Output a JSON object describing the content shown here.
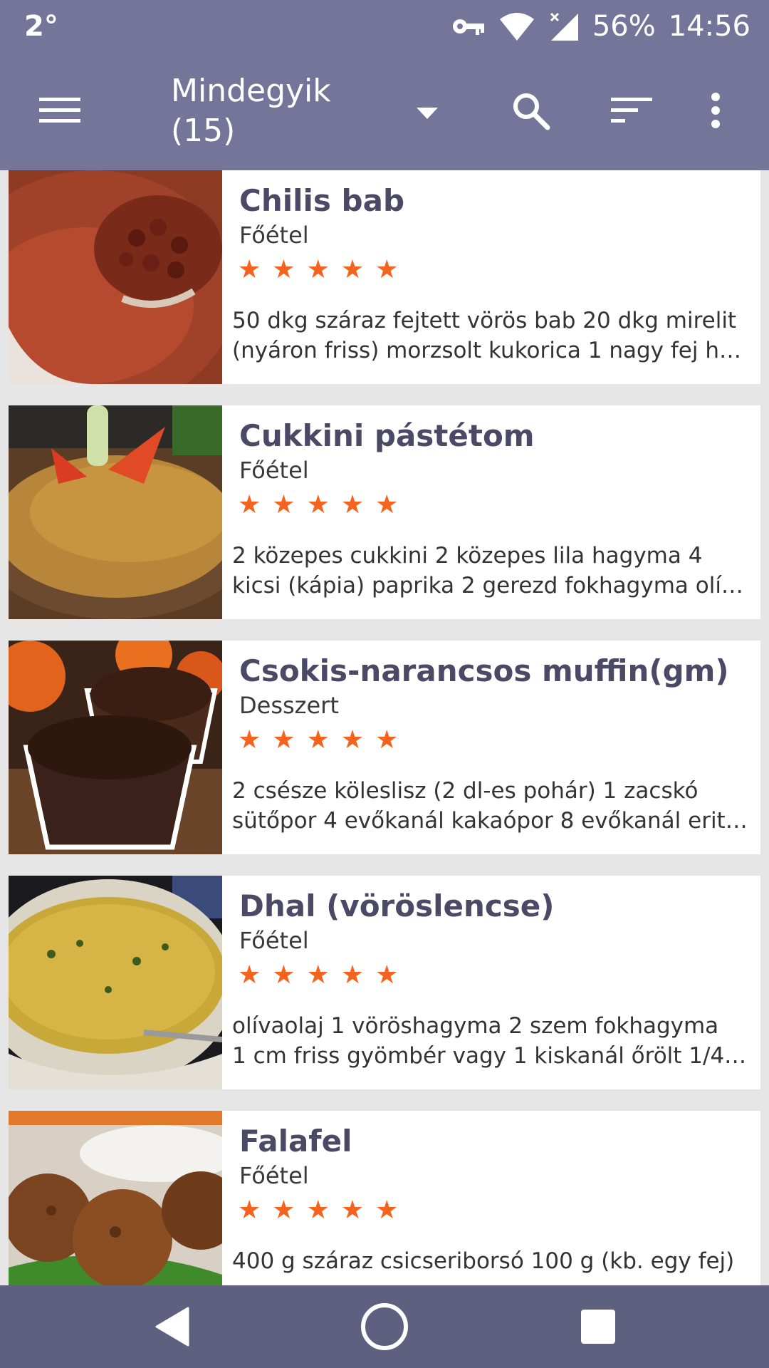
{
  "status": {
    "temperature": "2°",
    "battery": "56%",
    "time": "14:56"
  },
  "appbar": {
    "title_line1": "Mindegyik",
    "title_line2": "(15)"
  },
  "recipes": [
    {
      "title": "Chilis bab",
      "category": "Főétel",
      "rating": 5,
      "desc_line1": "50 dkg száraz fejtett vörös bab 20 dkg mirelit",
      "desc_line2": "(nyáron friss) morzsolt kukorica 1 nagy fej h…"
    },
    {
      "title": "Cukkini pástétom",
      "category": "Főétel",
      "rating": 5,
      "desc_line1": "2 közepes cukkini 2 közepes lila hagyma 4",
      "desc_line2": "kicsi (kápia) paprika 2 gerezd fokhagyma olí…"
    },
    {
      "title": "Csokis-narancsos muffin(gm)",
      "category": "Desszert",
      "rating": 5,
      "desc_line1": "2 csésze köleslisz (2 dl-es pohár) 1 zacskó",
      "desc_line2": "sütőpor 4 evőkanál kakaópor 8 evőkanál erit…"
    },
    {
      "title": "Dhal (vöröslencse)",
      "category": "Főétel",
      "rating": 5,
      "desc_line1": "olívaolaj 1 vöröshagyma 2 szem fokhagyma",
      "desc_line2": "1 cm friss gyömbér vagy 1 kiskanál őrölt 1/4…"
    },
    {
      "title": "Falafel",
      "category": "Főétel",
      "rating": 5,
      "desc_line1": "400 g száraz csicseriborsó 100 g (kb. egy fej)",
      "desc_line2": ""
    }
  ],
  "star_glyph": "★",
  "colors": {
    "appbar": "#757599",
    "navbar": "#5f5f80",
    "star": "#f5641e",
    "title": "#4a4a66"
  }
}
